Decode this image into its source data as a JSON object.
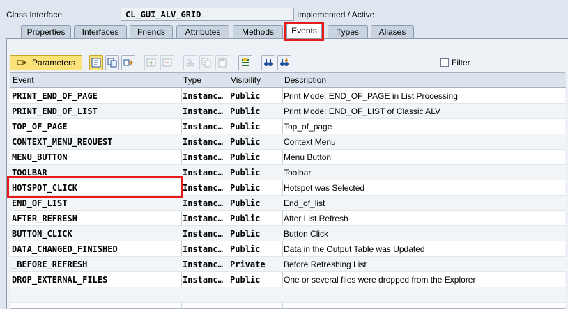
{
  "header": {
    "label": "Class Interface",
    "class_name": "CL_GUI_ALV_GRID",
    "status": "Implemented / Active"
  },
  "tabs": [
    {
      "label": "Properties",
      "active": false
    },
    {
      "label": "Interfaces",
      "active": false
    },
    {
      "label": "Friends",
      "active": false
    },
    {
      "label": "Attributes",
      "active": false
    },
    {
      "label": "Methods",
      "active": false
    },
    {
      "label": "Events",
      "active": true
    },
    {
      "label": "Types",
      "active": false
    },
    {
      "label": "Aliases",
      "active": false
    }
  ],
  "toolbar": {
    "parameters_label": "Parameters",
    "filter_label": "Filter"
  },
  "grid": {
    "columns": [
      "Event",
      "Type",
      "Visibility",
      "Description"
    ],
    "rows": [
      {
        "event": "PRINT_END_OF_PAGE",
        "type": "Instanc…",
        "visibility": "Public",
        "description": "Print Mode: END_OF_PAGE in List Processing"
      },
      {
        "event": "PRINT_END_OF_LIST",
        "type": "Instanc…",
        "visibility": "Public",
        "description": "Print Mode: END_OF_LIST of Classic ALV"
      },
      {
        "event": "TOP_OF_PAGE",
        "type": "Instanc…",
        "visibility": "Public",
        "description": "Top_of_page"
      },
      {
        "event": "CONTEXT_MENU_REQUEST",
        "type": "Instanc…",
        "visibility": "Public",
        "description": "Context Menu"
      },
      {
        "event": "MENU_BUTTON",
        "type": "Instanc…",
        "visibility": "Public",
        "description": "Menu Button"
      },
      {
        "event": "TOOLBAR",
        "type": "Instanc…",
        "visibility": "Public",
        "description": "Toolbar"
      },
      {
        "event": "HOTSPOT_CLICK",
        "type": "Instanc…",
        "visibility": "Public",
        "description": "Hotspot was Selected"
      },
      {
        "event": "END_OF_LIST",
        "type": "Instanc…",
        "visibility": "Public",
        "description": "End_of_list"
      },
      {
        "event": "AFTER_REFRESH",
        "type": "Instanc…",
        "visibility": "Public",
        "description": "After List Refresh"
      },
      {
        "event": "BUTTON_CLICK",
        "type": "Instanc…",
        "visibility": "Public",
        "description": "Button Click"
      },
      {
        "event": "DATA_CHANGED_FINISHED",
        "type": "Instanc…",
        "visibility": "Public",
        "description": "Data in the Output Table was Updated"
      },
      {
        "event": "_BEFORE_REFRESH",
        "type": "Instanc…",
        "visibility": "Private",
        "description": "Before Refreshing List"
      },
      {
        "event": "DROP_EXTERNAL_FILES",
        "type": "Instanc…",
        "visibility": "Public",
        "description": "One or several files were dropped from the Explorer"
      }
    ]
  },
  "colors": {
    "highlight": "#e8191b",
    "background": "#dfe6ef",
    "button_yellow": "#fbe37a"
  }
}
